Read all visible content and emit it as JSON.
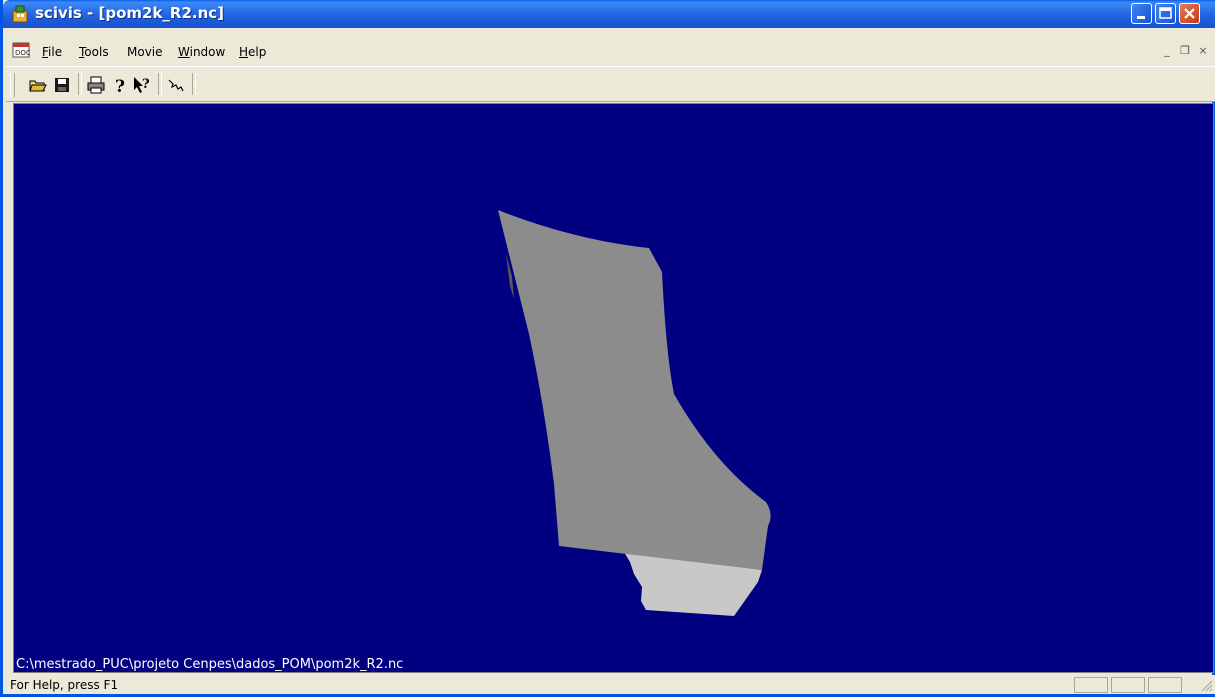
{
  "window": {
    "title": "scivis - [pom2k_R2.nc]",
    "controls": {
      "minimize": "minimize",
      "maximize": "maximize",
      "close": "close"
    }
  },
  "menubar": {
    "items": [
      {
        "label_underline": "F",
        "label_rest": "ile"
      },
      {
        "label_underline": "T",
        "label_rest": "ools"
      },
      {
        "label_underline": "",
        "label_rest": "Movie"
      },
      {
        "label_underline": "W",
        "label_rest": "indow"
      },
      {
        "label_underline": "H",
        "label_rest": "elp"
      }
    ],
    "mdi_controls": {
      "minimize": "_",
      "restore": "❐",
      "close": "×"
    }
  },
  "toolbar": {
    "buttons": [
      {
        "name": "open-icon"
      },
      {
        "name": "save-icon"
      },
      {
        "name": "print-icon"
      },
      {
        "name": "help-about-icon"
      },
      {
        "name": "context-help-icon"
      },
      {
        "name": "curve-tool-icon"
      }
    ]
  },
  "viewport": {
    "background": "#000080",
    "surface_main_color": "#8c8c8c",
    "surface_side_color": "#c8c8c8",
    "file_path": "C:\\mestrado_PUC\\projeto Cenpes\\dados_POM\\pom2k_R2.nc"
  },
  "statusbar": {
    "text": "For Help, press F1"
  }
}
